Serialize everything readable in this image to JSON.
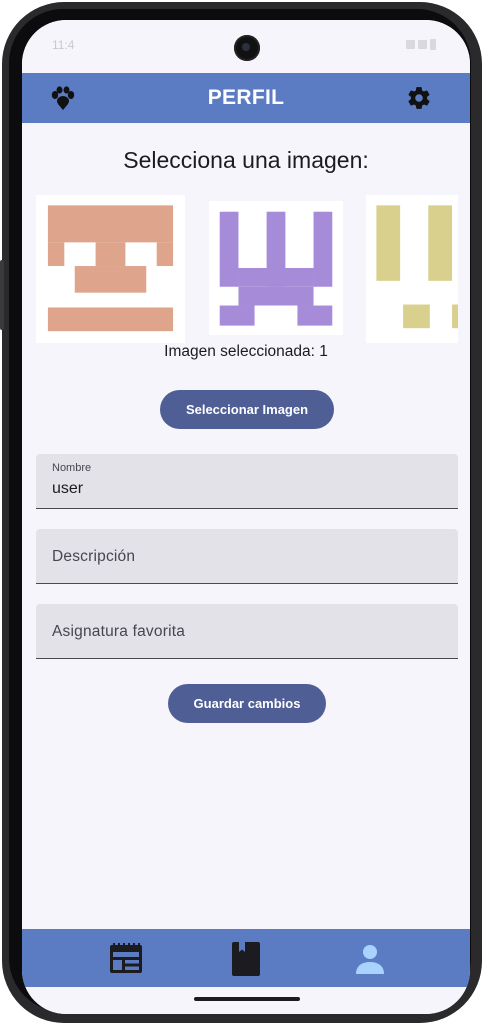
{
  "status_bar": {
    "time_text": "11:4",
    "icons": [
      "wifi-icon",
      "signal-icon",
      "battery-icon"
    ]
  },
  "app_bar": {
    "title": "PERFIL",
    "left_icon": "paw-icon",
    "right_icon": "gear-icon",
    "background": "#5b7cc3"
  },
  "main": {
    "heading": "Selecciona una imagen:",
    "images": [
      {
        "name": "avatar-1",
        "color": "#dea58c"
      },
      {
        "name": "avatar-2",
        "color": "#a68cd8"
      },
      {
        "name": "avatar-3",
        "color": "#d8d08c"
      }
    ],
    "selected_text": "Imagen seleccionada: 1",
    "select_button_label": "Seleccionar Imagen",
    "fields": {
      "name": {
        "label": "Nombre",
        "value": "user"
      },
      "description": {
        "placeholder": "Descripción"
      },
      "favorite_subject": {
        "placeholder": "Asignatura favorita"
      }
    },
    "save_button_label": "Guardar cambios",
    "button_color": "#4f5f95"
  },
  "bottom_nav": {
    "items": [
      {
        "name": "calendar-icon",
        "selected": false
      },
      {
        "name": "book-icon",
        "selected": false
      },
      {
        "name": "person-icon",
        "selected": true
      }
    ],
    "icon_color": "#1c1b1f",
    "selected_color": "#a9d2ff"
  }
}
